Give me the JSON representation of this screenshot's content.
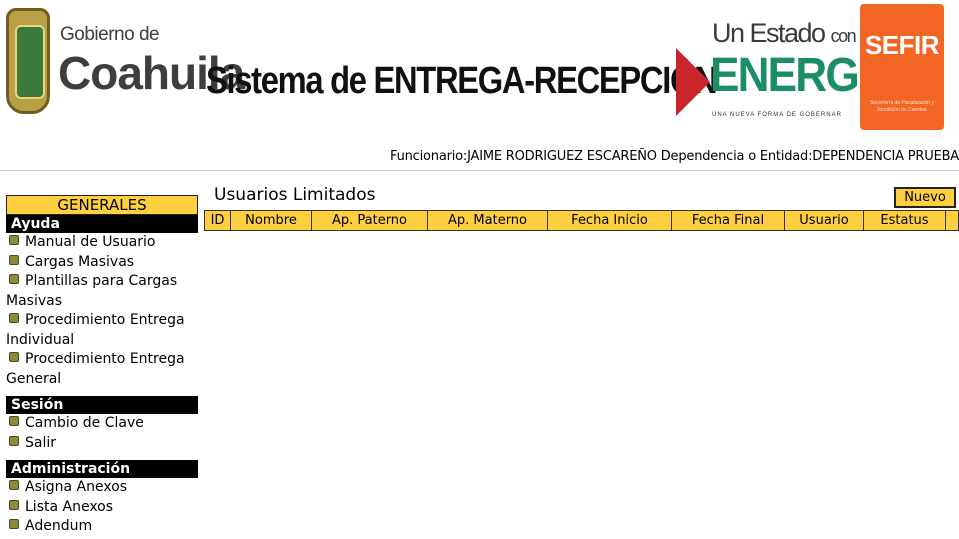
{
  "header": {
    "gobierno_small": "Gobierno de",
    "gobierno_big": "Coahuila",
    "system_title": "Sistema de ENTREGA-RECEPCIÓN",
    "energia_line1": "Un Estado",
    "energia_line1_small": "con",
    "energia_line2": "ENERGIA",
    "energia_line3": "UNA NUEVA FORMA DE GOBERNAR",
    "sefir_word": "SEFIR",
    "sefir_sub": "Secretaría de Fiscalización y Rendición de Cuentas",
    "funcionario_label": "Funcionario:",
    "funcionario_name": "JAIME RODRIGUEZ ESCAREÑO",
    "dependencia_label": " Dependencia o Entidad:",
    "dependencia_name": "DEPENDENCIA PRUEBA"
  },
  "sidebar": {
    "menu_title": "GENERALES",
    "sections": [
      {
        "title": "Ayuda",
        "items": [
          "Manual de Usuario",
          "Cargas Masivas",
          "Plantillas para Cargas Masivas",
          "Procedimiento Entrega Individual",
          "Procedimiento Entrega General"
        ]
      },
      {
        "title": "Sesión",
        "items": [
          "Cambio de Clave",
          "Salir"
        ]
      },
      {
        "title": "Administración",
        "items": [
          "Asigna Anexos",
          "Lista Anexos",
          "Adendum"
        ]
      }
    ]
  },
  "main": {
    "title": "Usuarios Limitados",
    "new_button": "Nuevo",
    "columns": [
      "ID",
      "Nombre",
      "Ap. Paterno",
      "Ap. Materno",
      "Fecha Inicio",
      "Fecha Final",
      "Usuario",
      "Estatus",
      ""
    ]
  },
  "colors": {
    "accent_yellow": "#fecf3f",
    "section_black": "#000000",
    "sefir_orange": "#f26522",
    "energia_green": "#1b8f63",
    "energia_red": "#c8262b"
  }
}
